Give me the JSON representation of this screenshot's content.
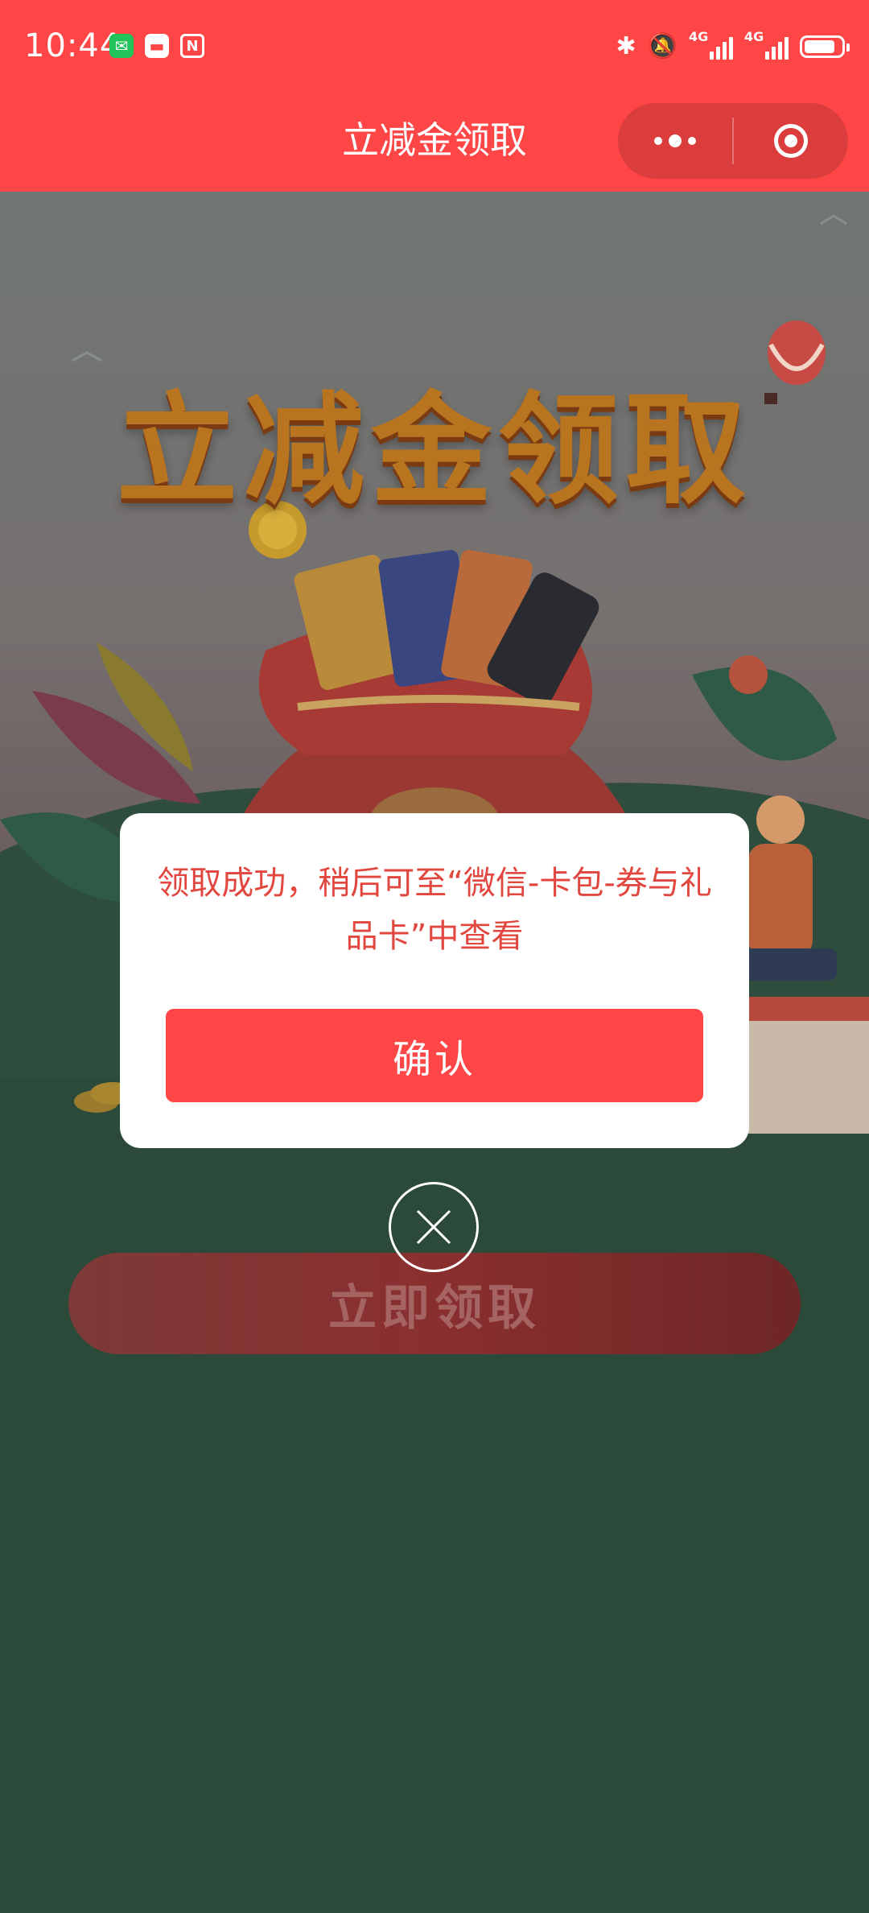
{
  "status_bar": {
    "time": "10:44",
    "network_tag_1": "4G",
    "network_tag_2": "4G",
    "battery_level": 0.85
  },
  "nav": {
    "title": "立减金领取"
  },
  "hero": {
    "title": "立减金领取"
  },
  "main": {
    "claim_button_label": "立即领取"
  },
  "dialog": {
    "message": "领取成功，稍后可至“微信-卡包-券与礼品卡”中查看",
    "confirm_label": "确认"
  },
  "colors": {
    "brand_red": "#ff4646",
    "message_red": "#e2473f",
    "background_green": "#2b4a39"
  },
  "icons": {
    "capsule_more": "more-dots-icon",
    "capsule_close": "target-icon",
    "dialog_close": "close-icon"
  }
}
